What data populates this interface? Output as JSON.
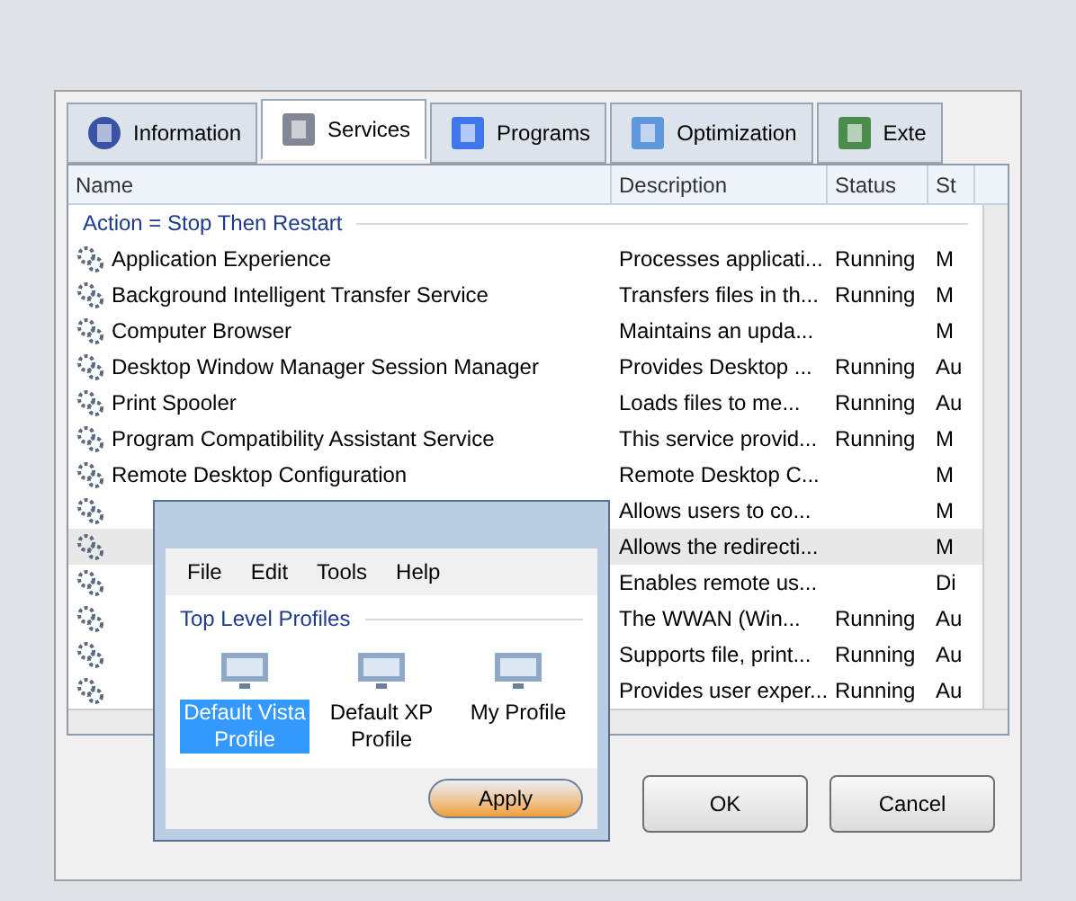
{
  "tabs": [
    {
      "label": "Information",
      "selected": false
    },
    {
      "label": "Services",
      "selected": true
    },
    {
      "label": "Programs",
      "selected": false
    },
    {
      "label": "Optimization",
      "selected": false
    },
    {
      "label": "Exte",
      "selected": false
    }
  ],
  "table": {
    "columns": [
      "Name",
      "Description",
      "Status",
      "St"
    ],
    "group": "Action = Stop Then Restart",
    "rows": [
      {
        "name": "Application Experience",
        "description": "Processes applicati...",
        "status": "Running",
        "startup": "M",
        "selected": false
      },
      {
        "name": "Background Intelligent Transfer Service",
        "description": "Transfers files in th...",
        "status": "Running",
        "startup": "M",
        "selected": false
      },
      {
        "name": "Computer Browser",
        "description": "Maintains an upda...",
        "status": "",
        "startup": "M",
        "selected": false
      },
      {
        "name": "Desktop Window Manager Session Manager",
        "description": "Provides Desktop ...",
        "status": "Running",
        "startup": "Au",
        "selected": false
      },
      {
        "name": "Print Spooler",
        "description": "Loads files to me...",
        "status": "Running",
        "startup": "Au",
        "selected": false
      },
      {
        "name": "Program Compatibility Assistant Service",
        "description": "This service provid...",
        "status": "Running",
        "startup": "M",
        "selected": false
      },
      {
        "name": "Remote Desktop Configuration",
        "description": "Remote Desktop C...",
        "status": "",
        "startup": "M",
        "selected": false
      },
      {
        "description": "Allows users to co...",
        "status": "",
        "startup": "M",
        "selected": false
      },
      {
        "description": "Allows the redirecti...",
        "status": "",
        "startup": "M",
        "selected": true
      },
      {
        "description": "Enables remote us...",
        "status": "",
        "startup": "Di",
        "selected": false
      },
      {
        "description": "The WWAN (Win...",
        "status": "Running",
        "startup": "Au",
        "selected": false
      },
      {
        "description": "Supports file, print...",
        "status": "Running",
        "startup": "Au",
        "selected": false
      },
      {
        "description": "Provides user exper...",
        "status": "Running",
        "startup": "Au",
        "selected": false
      }
    ]
  },
  "buttons": [
    "OK",
    "Cancel"
  ],
  "profiles_window": {
    "menu": [
      "File",
      "Edit",
      "Tools",
      "Help"
    ],
    "group": "Top Level Profiles",
    "profiles": [
      {
        "label": "Default Vista Profile",
        "selected": true
      },
      {
        "label": "Default XP Profile",
        "selected": false
      },
      {
        "label": "My Profile",
        "selected": false
      }
    ],
    "button": "Apply"
  }
}
